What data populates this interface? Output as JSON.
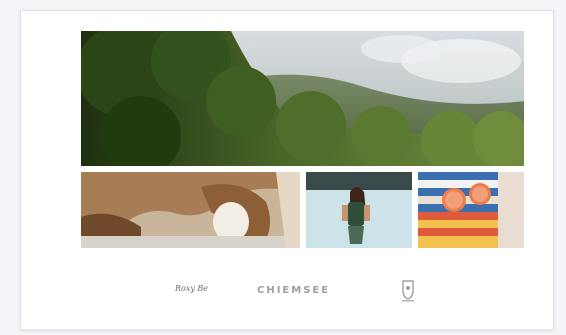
{
  "brands": [
    {
      "label": "Roxy Be",
      "icon": "script-logo"
    },
    {
      "label": "CHIEMSEE",
      "icon": "wordmark-logo"
    },
    {
      "label": "",
      "icon": "crest-logo"
    }
  ],
  "colors": {
    "card_bg": "#ffffff",
    "page_bg": "#f3f5f8",
    "border": "#dde4ee"
  }
}
